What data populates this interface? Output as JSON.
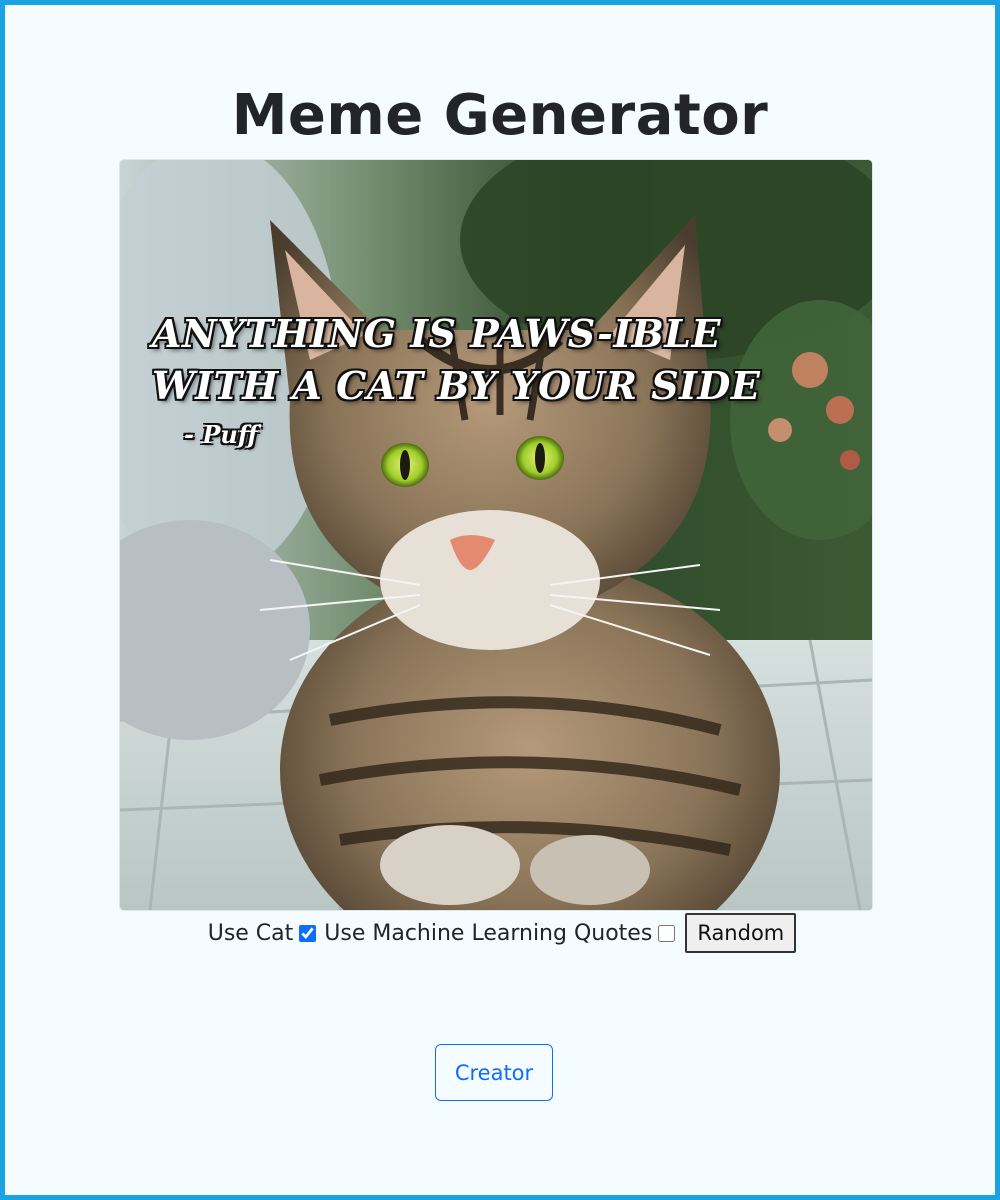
{
  "page": {
    "title": "Meme Generator"
  },
  "meme": {
    "quote": "ANYTHING IS PAWS-IBLE WITH A CAT BY YOUR SIDE",
    "author": "- Puff",
    "image_subject": "tabby cat lying on tiles in front of green foliage"
  },
  "controls": {
    "use_cat_label": "Use Cat",
    "use_cat_checked": true,
    "use_ml_quotes_label": "Use Machine Learning Quotes",
    "use_ml_quotes_checked": false,
    "random_label": "Random"
  },
  "footer": {
    "creator_label": "Creator"
  },
  "colors": {
    "frame_border": "#1aa3e0",
    "page_background": "#f5fcff",
    "primary": "#0d6efd"
  }
}
